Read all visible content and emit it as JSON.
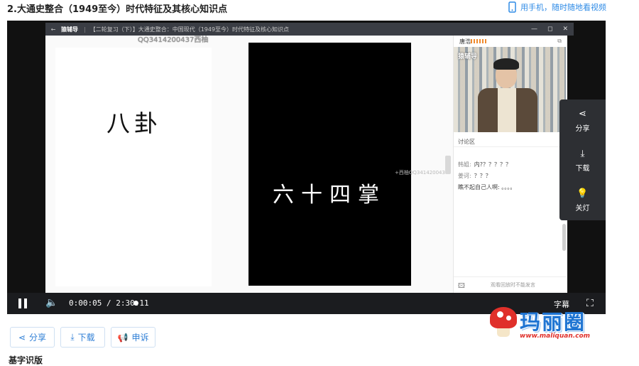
{
  "page": {
    "title": "2.大通史整合（1949至今）时代特征及其核心知识点",
    "mobile_link": "用手机，随时随地看视频",
    "bottom_heading": "基字识版"
  },
  "window_bar": {
    "back": "←",
    "brand": "猿辅导",
    "separator": "|",
    "course_title": "【二轮复习（下）】大通史整合：中国现代（1949至今）时代特征及核心知识点",
    "min": "—",
    "restore": "◻",
    "close": "✕"
  },
  "watermarks": {
    "top": "QQ3414200437西柚",
    "middle": "+西柚QQ3414200437"
  },
  "board": {
    "text_left": "八卦",
    "text_right": "六十四掌"
  },
  "side_panel": {
    "teacher_name": "唐浩",
    "camera_logo": "猿辅导",
    "discussion_title": "讨论区",
    "messages": [
      {
        "user": "韩姐:",
        "text": "内?？？？？？"
      },
      {
        "user": "姜诃:",
        "text": "？？？"
      },
      {
        "user": "",
        "text": "瞧不起自己人啊: 。。。。"
      }
    ],
    "footer_note": "观看回放时不能发言"
  },
  "float_menu": {
    "share": "分享",
    "download": "下载",
    "light_off": "关灯"
  },
  "player": {
    "current_time": "0:00:05",
    "separator": "/",
    "total_time": "2:30:11",
    "progress_fraction": 0.0006,
    "subtitle_label": "字幕"
  },
  "actions": {
    "share": "分享",
    "download": "下载",
    "report": "申诉"
  },
  "brand": {
    "name": "玛丽圈",
    "url": "www.maliquan.com"
  },
  "colors": {
    "accent": "#2f7fd6",
    "brand_red": "#e0302a"
  }
}
